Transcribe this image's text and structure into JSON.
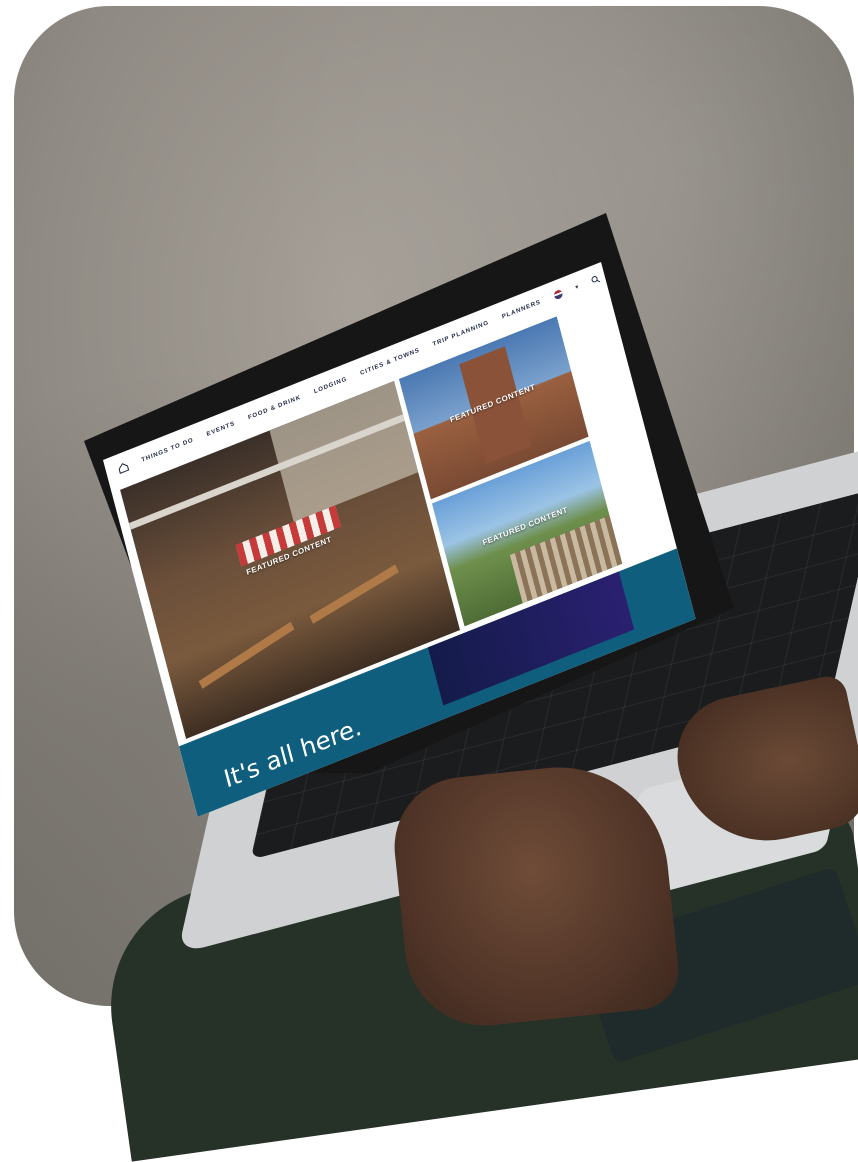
{
  "site": {
    "nav": {
      "items": [
        "THINGS TO DO",
        "EVENTS",
        "FOOD & DRINK",
        "LODGING",
        "CITIES & TOWNS",
        "TRIP PLANNING",
        "PLANNERS"
      ],
      "home_icon": "home-icon",
      "language_icon": "us-flag-icon",
      "search_icon": "search-icon"
    },
    "hero": {
      "featured_label": "FEATURED CONTENT"
    },
    "cards": [
      {
        "featured_label": "FEATURED CONTENT"
      },
      {
        "featured_label": "FEATURED CONTENT"
      }
    ],
    "band": {
      "tagline": "It's all here."
    }
  },
  "colors": {
    "band_teal": "#0f5e7e",
    "promo_navy": "#141b4a",
    "nav_text": "#1f2a44"
  }
}
